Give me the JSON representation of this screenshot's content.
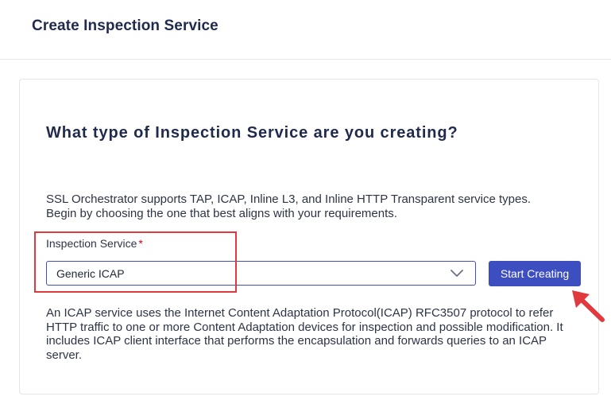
{
  "header": {
    "title": "Create Inspection Service"
  },
  "card": {
    "title": "What type of Inspection Service are you creating?",
    "intro_line1": "SSL Orchestrator supports TAP, ICAP, Inline L3, and Inline HTTP Transparent service types.",
    "intro_line2": "Begin by choosing the one that best aligns with your requirements.",
    "field": {
      "label": "Inspection Service",
      "required_marker": "*",
      "selected_value": "Generic ICAP"
    },
    "start_button_label": "Start Creating",
    "description": "An ICAP service uses the Internet Content Adaptation Protocol(ICAP) RFC3507 protocol to refer HTTP traffic to one or more Content Adaptation devices for inspection and possible modification. It includes ICAP client interface that performs the encapsulation and forwards queries to an ICAP server."
  },
  "icons": {
    "dropdown": "chevron-down-icon",
    "annotation_arrow": "arrow-icon"
  },
  "colors": {
    "accent": "#3d4fc0",
    "title_text": "#1f2a4d",
    "annotation": "#e0393e",
    "required": "#d0021b"
  }
}
